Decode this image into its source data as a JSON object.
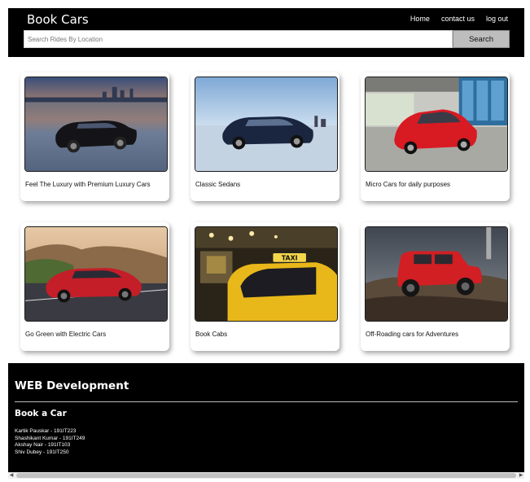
{
  "header": {
    "brand": "Book Cars",
    "nav": [
      {
        "label": "Home"
      },
      {
        "label": "contact us"
      },
      {
        "label": "log out"
      }
    ]
  },
  "search": {
    "placeholder": "Search Rides By Location",
    "value": "",
    "button_label": "Search"
  },
  "cards": [
    {
      "caption": "Feel The Luxury with Premium Luxury Cars",
      "image": "black-luxury-sedan-city-sunset"
    },
    {
      "caption": "Classic Sedans",
      "image": "dark-blue-sedan-waterfront"
    },
    {
      "caption": "Micro Cars for daily purposes",
      "image": "red-hatchback-modern-building"
    },
    {
      "caption": "Go Green with Electric Cars",
      "image": "red-electric-car-mountain-road"
    },
    {
      "caption": "Book Cabs",
      "image": "yellow-taxi-city-night"
    },
    {
      "caption": "Off-Roading cars for Adventures",
      "image": "red-jeep-rocky-terrain"
    }
  ],
  "footer": {
    "title": "WEB Development",
    "subtitle": "Book a Car",
    "members": [
      "Kartik Pauskar - 191IT223",
      "Shashikant Kumar - 191IT249",
      "Akshay Nair - 191IT103",
      "Shiv Dubey - 191IT250"
    ]
  },
  "colors": {
    "navbar_bg": "#000000",
    "footer_bg": "#000000",
    "search_button_bg": "#bdbdbd",
    "page_bg": "#ffffff"
  }
}
